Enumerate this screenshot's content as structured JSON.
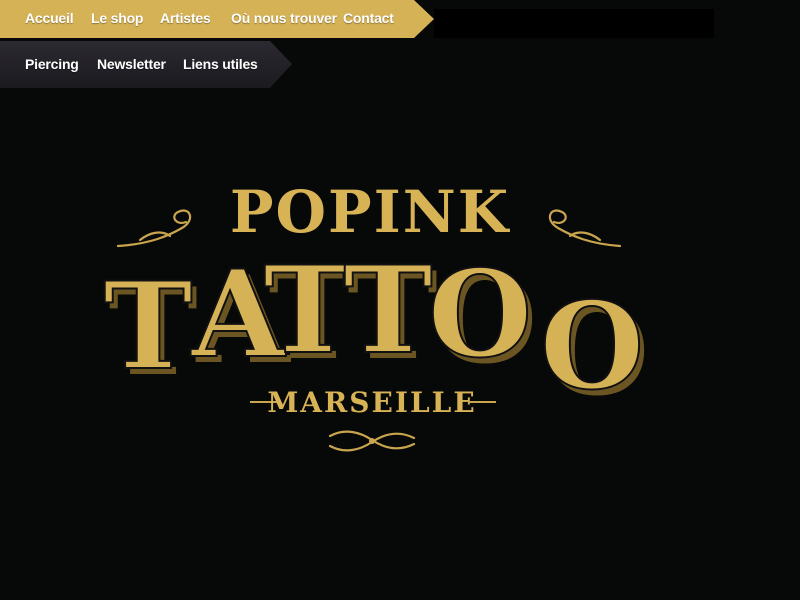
{
  "colors": {
    "gold": "#d6b256",
    "gold_shadow": "#6b5623",
    "bg": "#070808",
    "nav_dark": "#25232a"
  },
  "nav_primary": {
    "items": [
      {
        "label": "Accueil"
      },
      {
        "label": "Le shop"
      },
      {
        "label": "Artistes"
      },
      {
        "label": "Où nous trouver"
      },
      {
        "label": "Contact"
      }
    ]
  },
  "nav_secondary": {
    "items": [
      {
        "label": "Piercing"
      },
      {
        "label": "Newsletter"
      },
      {
        "label": "Liens utiles"
      }
    ]
  },
  "logo": {
    "line1": "POPINK",
    "line2_letters": [
      "T",
      "A",
      "T",
      "T",
      "O",
      "O"
    ],
    "line3": "MARSEILLE",
    "icons": [
      "swirl-left-ornament",
      "swirl-right-ornament",
      "flourish-ornament"
    ]
  }
}
